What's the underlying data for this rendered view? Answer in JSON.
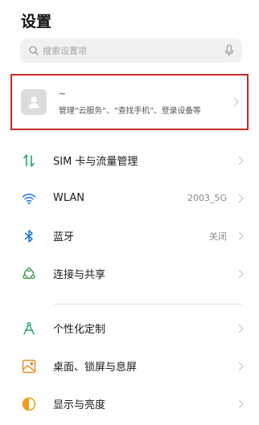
{
  "header": {
    "title": "设置"
  },
  "search": {
    "placeholder": "搜索设置项"
  },
  "account": {
    "name": "~",
    "description": "管理“云服务”、“查找手机”、登录设备等"
  },
  "settings": [
    {
      "label": "SIM 卡与流量管理",
      "value": "",
      "icon": "sim-data-icon",
      "color": "#1fa37f"
    },
    {
      "label": "WLAN",
      "value": "2003_5G",
      "icon": "wifi-icon",
      "color": "#1a73e8"
    },
    {
      "label": "蓝牙",
      "value": "关闭",
      "icon": "bluetooth-icon",
      "color": "#1a73e8"
    },
    {
      "label": "连接与共享",
      "value": "",
      "icon": "connection-share-icon",
      "color": "#3f9a4a"
    },
    {
      "label": "个性化定制",
      "value": "",
      "icon": "personalization-icon",
      "color": "#1fa37f"
    },
    {
      "label": "桌面、锁屏与息屏",
      "value": "",
      "icon": "home-lockscreen-icon",
      "color": "#f08a24"
    },
    {
      "label": "显示与亮度",
      "value": "",
      "icon": "display-brightness-icon",
      "color": "#f59a1b"
    }
  ],
  "colors": {
    "highlight_border": "#c92a2a",
    "search_bg": "#f1f1f3",
    "chevron": "#c4c4c4"
  }
}
